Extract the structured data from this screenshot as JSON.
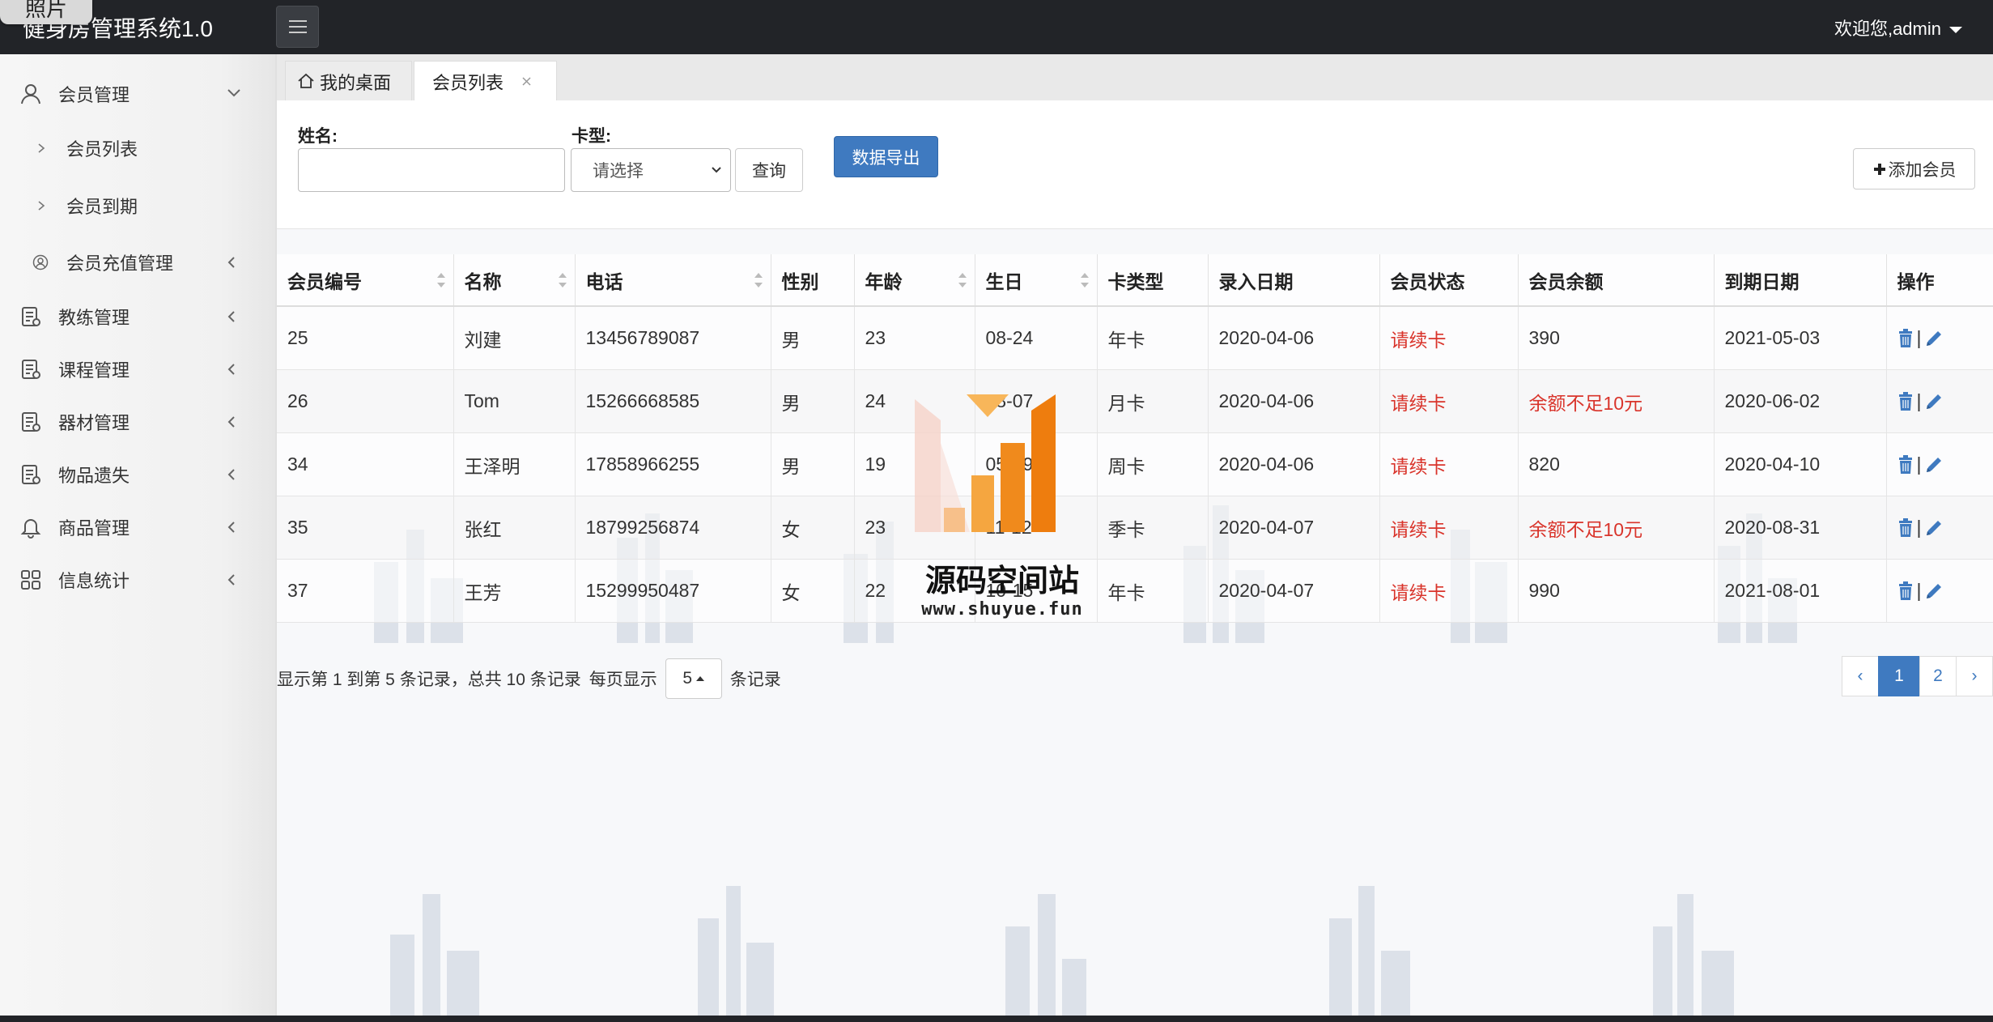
{
  "header": {
    "photo_tag": "照片",
    "app_title": "健身房管理系统1.0",
    "welcome": "欢迎您,admin"
  },
  "sidebar": {
    "items": [
      {
        "label": "会员管理",
        "icon": "user-icon",
        "expanded": true
      },
      {
        "label": "会员列表",
        "icon": "chevron-right-icon",
        "sub": true
      },
      {
        "label": "会员到期",
        "icon": "chevron-right-icon",
        "sub": true
      },
      {
        "label": "会员充值管理",
        "icon": "user-circle-icon",
        "sub": true
      },
      {
        "label": "教练管理",
        "icon": "document-icon"
      },
      {
        "label": "课程管理",
        "icon": "document-icon"
      },
      {
        "label": "器材管理",
        "icon": "document-icon"
      },
      {
        "label": "物品遗失",
        "icon": "document-icon"
      },
      {
        "label": "商品管理",
        "icon": "bell-icon"
      },
      {
        "label": "信息统计",
        "icon": "grid-icon"
      }
    ]
  },
  "tabs": {
    "home": "我的桌面",
    "active": "会员列表"
  },
  "search": {
    "name_label": "姓名:",
    "name_value": "",
    "card_label": "卡型:",
    "card_selected": "请选择",
    "query_button": "查询",
    "export_button": "数据导出",
    "add_button": "添加会员"
  },
  "table": {
    "columns": [
      "会员编号",
      "名称",
      "电话",
      "性别",
      "年龄",
      "生日",
      "卡类型",
      "录入日期",
      "会员状态",
      "会员余额",
      "到期日期",
      "操作"
    ],
    "rows": [
      {
        "id": "25",
        "name": "刘建",
        "phone": "13456789087",
        "gender": "男",
        "age": "23",
        "birthday": "08-24",
        "card": "年卡",
        "entry": "2020-04-06",
        "status": "请续卡",
        "balance": "390",
        "balance_low": false,
        "expire": "2021-05-03"
      },
      {
        "id": "26",
        "name": "Tom",
        "phone": "15266668585",
        "gender": "男",
        "age": "24",
        "birthday": "08-07",
        "card": "月卡",
        "entry": "2020-04-06",
        "status": "请续卡",
        "balance": "余额不足10元",
        "balance_low": true,
        "expire": "2020-06-02"
      },
      {
        "id": "34",
        "name": "王泽明",
        "phone": "17858966255",
        "gender": "男",
        "age": "19",
        "birthday": "05-09",
        "card": "周卡",
        "entry": "2020-04-06",
        "status": "请续卡",
        "balance": "820",
        "balance_low": false,
        "expire": "2020-04-10"
      },
      {
        "id": "35",
        "name": "张红",
        "phone": "18799256874",
        "gender": "女",
        "age": "23",
        "birthday": "11-12",
        "card": "季卡",
        "entry": "2020-04-07",
        "status": "请续卡",
        "balance": "余额不足10元",
        "balance_low": true,
        "expire": "2020-08-31"
      },
      {
        "id": "37",
        "name": "王芳",
        "phone": "15299950487",
        "gender": "女",
        "age": "22",
        "birthday": "10-15",
        "card": "年卡",
        "entry": "2020-04-07",
        "status": "请续卡",
        "balance": "990",
        "balance_low": false,
        "expire": "2021-08-01"
      }
    ],
    "op_separator": "|"
  },
  "pagination": {
    "summary": "显示第 1 到第 5 条记录，总共 10 条记录",
    "per_page_label": "每页显示",
    "per_page": "5",
    "per_page_suffix": "条记录",
    "prev": "‹",
    "pages": [
      "1",
      "2"
    ],
    "current": "1",
    "next": "›"
  },
  "watermark": {
    "title": "源码空间站",
    "url": "www.shuyue.fun"
  },
  "colors": {
    "primary": "#3f7ac0",
    "danger": "#d9342b",
    "topbar": "#222428"
  }
}
